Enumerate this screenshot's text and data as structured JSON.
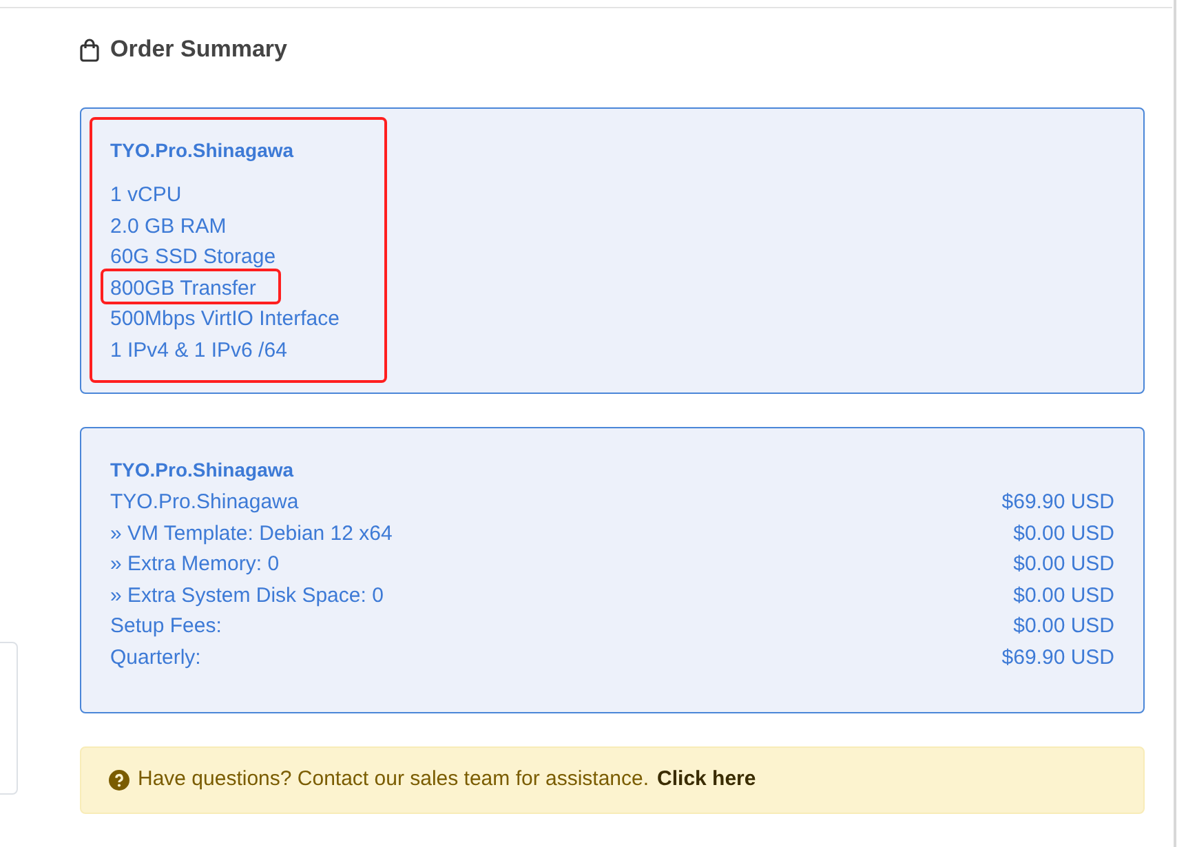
{
  "heading": "Order Summary",
  "product": {
    "name": "TYO.Pro.Shinagawa",
    "highlighted": true,
    "specs": [
      {
        "text": "1 vCPU",
        "highlighted": false
      },
      {
        "text": "2.0 GB RAM",
        "highlighted": false
      },
      {
        "text": "60G SSD Storage",
        "highlighted": false
      },
      {
        "text": "800GB Transfer",
        "highlighted": true
      },
      {
        "text": "500Mbps VirtIO Interface",
        "highlighted": false
      },
      {
        "text": "1 IPv4 & 1 IPv6 /64",
        "highlighted": false
      }
    ]
  },
  "summary": {
    "title": "TYO.Pro.Shinagawa",
    "lines": [
      {
        "label": "TYO.Pro.Shinagawa",
        "amount": "$69.90 USD"
      },
      {
        "label": "» VM Template: Debian 12 x64",
        "amount": "$0.00 USD"
      },
      {
        "label": "» Extra Memory: 0",
        "amount": "$0.00 USD"
      },
      {
        "label": "» Extra System Disk Space: 0",
        "amount": "$0.00 USD"
      },
      {
        "label": "Setup Fees:",
        "amount": "$0.00 USD"
      },
      {
        "label": "Quarterly:",
        "amount": "$69.90 USD"
      }
    ]
  },
  "notice": {
    "text": "Have questions? Contact our sales team for assistance.",
    "link": "Click here"
  }
}
